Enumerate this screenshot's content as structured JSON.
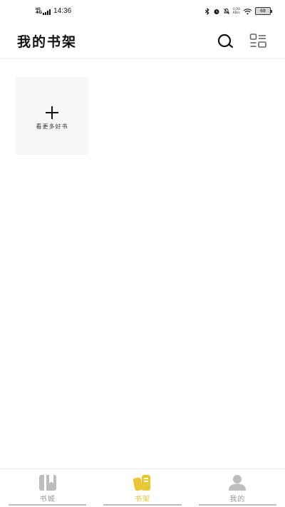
{
  "status_bar": {
    "network": "4G",
    "network_sub": "HD",
    "time": "14:36",
    "speed_value": "0.00",
    "speed_unit": "KB/s",
    "battery": "68"
  },
  "header": {
    "title": "我的书架",
    "search_icon": "search-icon",
    "list_icon": "list-view-icon"
  },
  "shelf": {
    "add_label": "看更多好书"
  },
  "bottom_nav": {
    "active_color": "#e8c832",
    "inactive_color": "#9a9a9a",
    "tabs": [
      {
        "label": "书城",
        "icon": "bookstore-icon"
      },
      {
        "label": "书架",
        "icon": "bookshelf-icon",
        "active": true
      },
      {
        "label": "我的",
        "icon": "profile-icon"
      }
    ]
  }
}
